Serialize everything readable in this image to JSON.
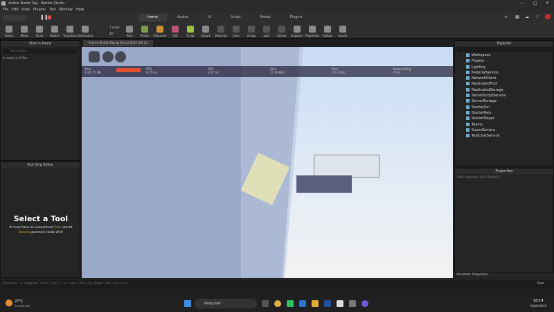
{
  "window": {
    "title": "Anime Bomb Tag - Roblox Studio"
  },
  "menu": [
    "File",
    "Edit",
    "View",
    "Plugins",
    "Test",
    "Window",
    "Help"
  ],
  "ribbon_tabs": [
    "Home",
    "Avatar",
    "UI",
    "Script",
    "Model",
    "Plugins"
  ],
  "tools": [
    "Select",
    "Move",
    "Scale",
    "Rotate",
    "Transform",
    "Generators",
    "Part",
    "Terrain",
    "Character",
    "GUI",
    "Script",
    "Import",
    "Material",
    "Color",
    "Group",
    "Lock",
    "Anchor",
    "Explorer",
    "Properties",
    "Toolbox",
    "Assets"
  ],
  "toggles": {
    "studs": "1 studs",
    "deg": "45°"
  },
  "find": {
    "title": "Find in Place",
    "placeholder": "Find in Place",
    "results": "0 results in 0 files"
  },
  "tool_grip": {
    "title": "Tool Grip Editor",
    "heading": "Select a Tool",
    "msg1": "It must have an unanchored",
    "part": "Part",
    "named": "named",
    "handle": "Handle",
    "msg2": "parented inside of it!"
  },
  "viewport_tab": "Anime Bomb Tag @ 03 Jul 2025 18:14",
  "stats": [
    {
      "k": "Mem",
      "v": "2185.55 MB"
    },
    {
      "k": "CPU",
      "v": "6.25 ms"
    },
    {
      "k": "GPU",
      "v": "3.37 ms"
    },
    {
      "k": "Sent",
      "v": "23.59 KB/s"
    },
    {
      "k": "Recv",
      "v": "4.61 KB/s"
    },
    {
      "k": "NetworkPing",
      "v": "0 ms"
    }
  ],
  "explorer": {
    "title": "Explorer",
    "items": [
      "Workspace",
      "Players",
      "Lighting",
      "MaterialService",
      "NetworkClient",
      "ReplicatedFirst",
      "ReplicatedStorage",
      "ServerScriptService",
      "ServerStorage",
      "StarterGui",
      "StarterPack",
      "StarterPlayer",
      "Teams",
      "SoundService",
      "TextChatService"
    ]
  },
  "properties": {
    "title": "Properties",
    "filter": "Filter Properties (Ctrl+Shift+P)",
    "tabs": [
      "Assistant",
      "Properties"
    ]
  },
  "command": {
    "placeholder": "Execute a command with Ctrl+ or use Ctrl+Up/Down for history",
    "run": "Run"
  },
  "taskbar": {
    "weather": "27°C",
    "weather_desc": "Ensolarado",
    "search": "Pesquisar",
    "time": "18:14",
    "date": "03/07/2025"
  }
}
